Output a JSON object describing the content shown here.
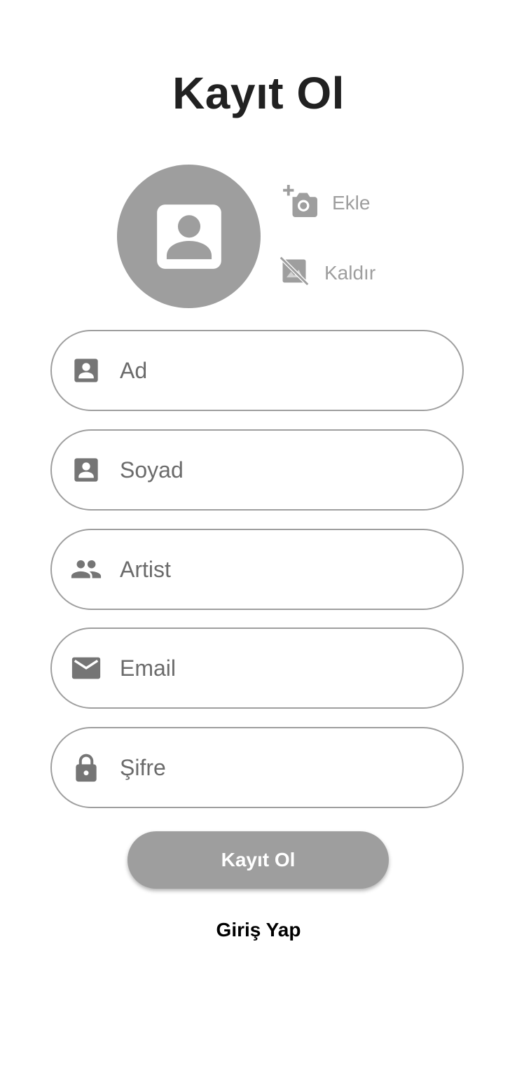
{
  "title": "Kayıt Ol",
  "avatar": {
    "icon": "account-box-icon"
  },
  "photo_actions": {
    "add_label": "Ekle",
    "add_icon": "add-a-photo-icon",
    "remove_label": "Kaldır",
    "remove_icon": "hide-image-icon"
  },
  "fields": {
    "first_name": {
      "placeholder": "Ad",
      "icon": "account-box-icon"
    },
    "last_name": {
      "placeholder": "Soyad",
      "icon": "account-box-icon"
    },
    "artist": {
      "placeholder": "Artist",
      "icon": "people-icon"
    },
    "email": {
      "placeholder": "Email",
      "icon": "email-icon"
    },
    "password": {
      "placeholder": "Şifre",
      "icon": "lock-icon"
    }
  },
  "submit_label": "Kayıt Ol",
  "login_link": "Giriş Yap",
  "colors": {
    "primary_gray": "#9e9e9e",
    "icon_gray": "#757575",
    "title": "#212121"
  }
}
